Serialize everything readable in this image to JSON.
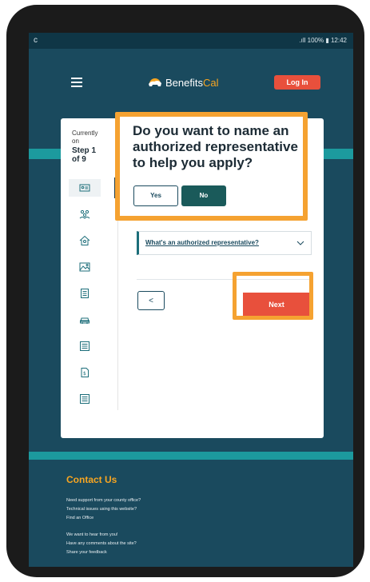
{
  "statusbar": {
    "left_glyph": "c",
    "right_text": ".ıll 100% ▮ 12:42"
  },
  "header": {
    "logo_part1": "Benefits",
    "logo_part2": "Cal",
    "login_label": "Log In"
  },
  "stepper": {
    "currently_label": "Currently on",
    "step_label": "Step 1 of 9",
    "icons": [
      "id-card-icon",
      "people-icon",
      "home-icon",
      "landscape-icon",
      "document-list-icon",
      "car-icon",
      "list-icon",
      "file-dollar-icon",
      "list-icon"
    ]
  },
  "popup": {
    "title": "Do you want to name an authorized representative to help you apply?",
    "yes_label": "Yes",
    "no_label": "No"
  },
  "faq": {
    "link_text": "What's an authorized representative?"
  },
  "nav": {
    "back_glyph": "<",
    "next_label": "Next"
  },
  "footer": {
    "title": "Contact Us",
    "lines": [
      "Need support from your county office?",
      "Technical issues using this website?",
      "Find an Office"
    ],
    "lines2": [
      "We want to hear from you!",
      "Have any comments about the site?",
      "Share your feedback"
    ]
  },
  "colors": {
    "primary": "#1a4a5e",
    "teal": "#1c9a9e",
    "accent_red": "#e8503c",
    "highlight_orange": "#f5a231",
    "brand_gold": "#f7a521"
  }
}
